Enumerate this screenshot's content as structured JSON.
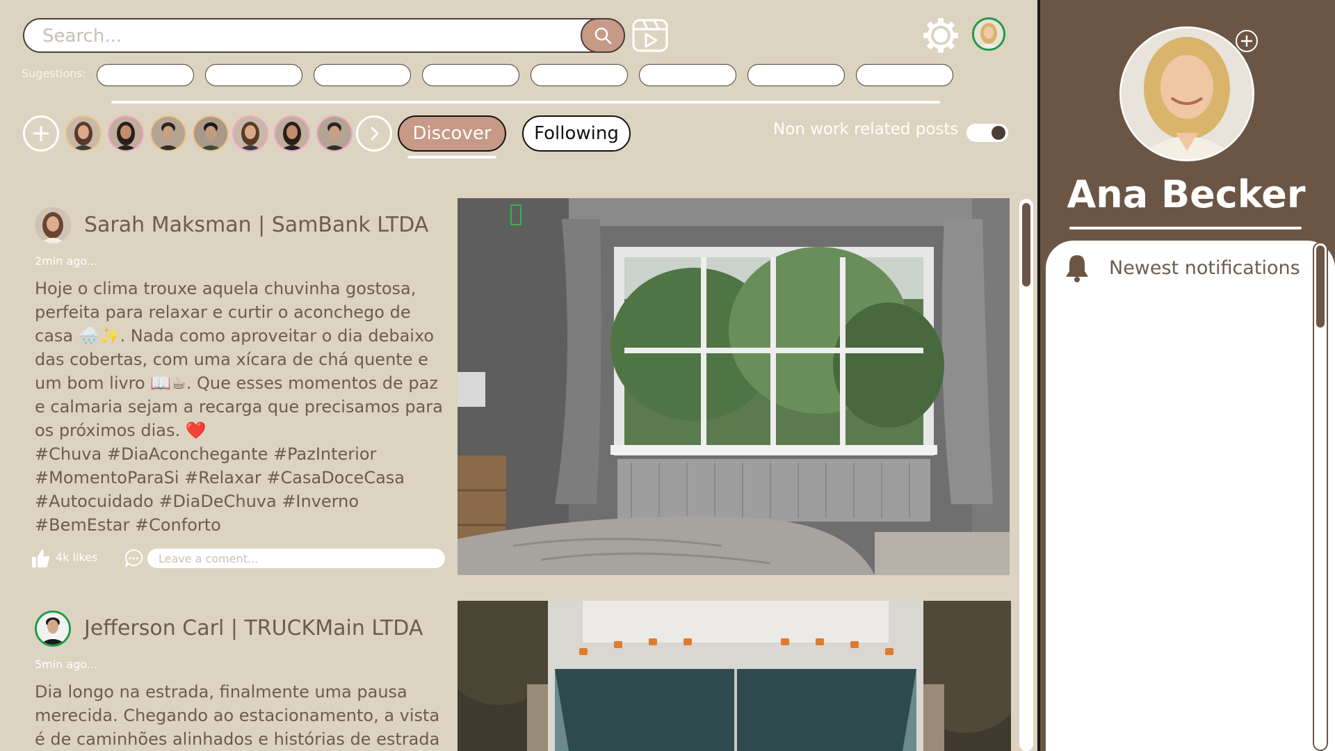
{
  "search": {
    "placeholder": "Search..."
  },
  "suggestions": {
    "label": "Sugestions:",
    "items": [
      "",
      "",
      "",
      "",
      "",
      "",
      "",
      ""
    ]
  },
  "feed_tabs": {
    "discover": "Discover",
    "following": "Following",
    "active": "Discover"
  },
  "filter_toggle": {
    "label": "Non work related posts",
    "on": true
  },
  "posts": [
    {
      "author": "Sarah Maksman | SamBank LTDA",
      "time": "2min ago...",
      "text": "Hoje o clima trouxe aquela chuvinha gostosa, perfeita para relaxar e curtir o aconchego de casa 🌧️✨. Nada como aproveitar o dia debaixo das cobertas, com uma xícara de chá quente e um bom livro 📖☕. Que esses momentos de paz e calmaria sejam a recarga que precisamos para os próximos dias. ❤️",
      "tags": "#Chuva #DiaAconchegante #PazInterior #MomentoParaSi #Relaxar #CasaDoceCasa #Autocuidado #DiaDeChuva #Inverno #BemEstar #Conforto",
      "likes": "4k likes",
      "comment_placeholder": "Leave a coment..."
    },
    {
      "author": "Jefferson Carl | TRUCKMain LTDA",
      "time": "5min ago...",
      "text": "Dia longo na estrada, finalmente uma pausa merecida. Chegando ao estacionamento, a vista é de caminhões alinhados e histórias de estrada em"
    }
  ],
  "profile": {
    "name": "Ana Becker"
  },
  "notifications": {
    "title": "Newest notifications"
  },
  "colors": {
    "background": "#ddd3c1",
    "panel": "#6b5646",
    "accent": "#c69a86",
    "online": "#1e9c46"
  },
  "icons": [
    "search-icon",
    "video-play-icon",
    "gear-icon",
    "plus-icon",
    "chevron-right-icon",
    "like-icon",
    "comment-icon",
    "bell-icon"
  ]
}
